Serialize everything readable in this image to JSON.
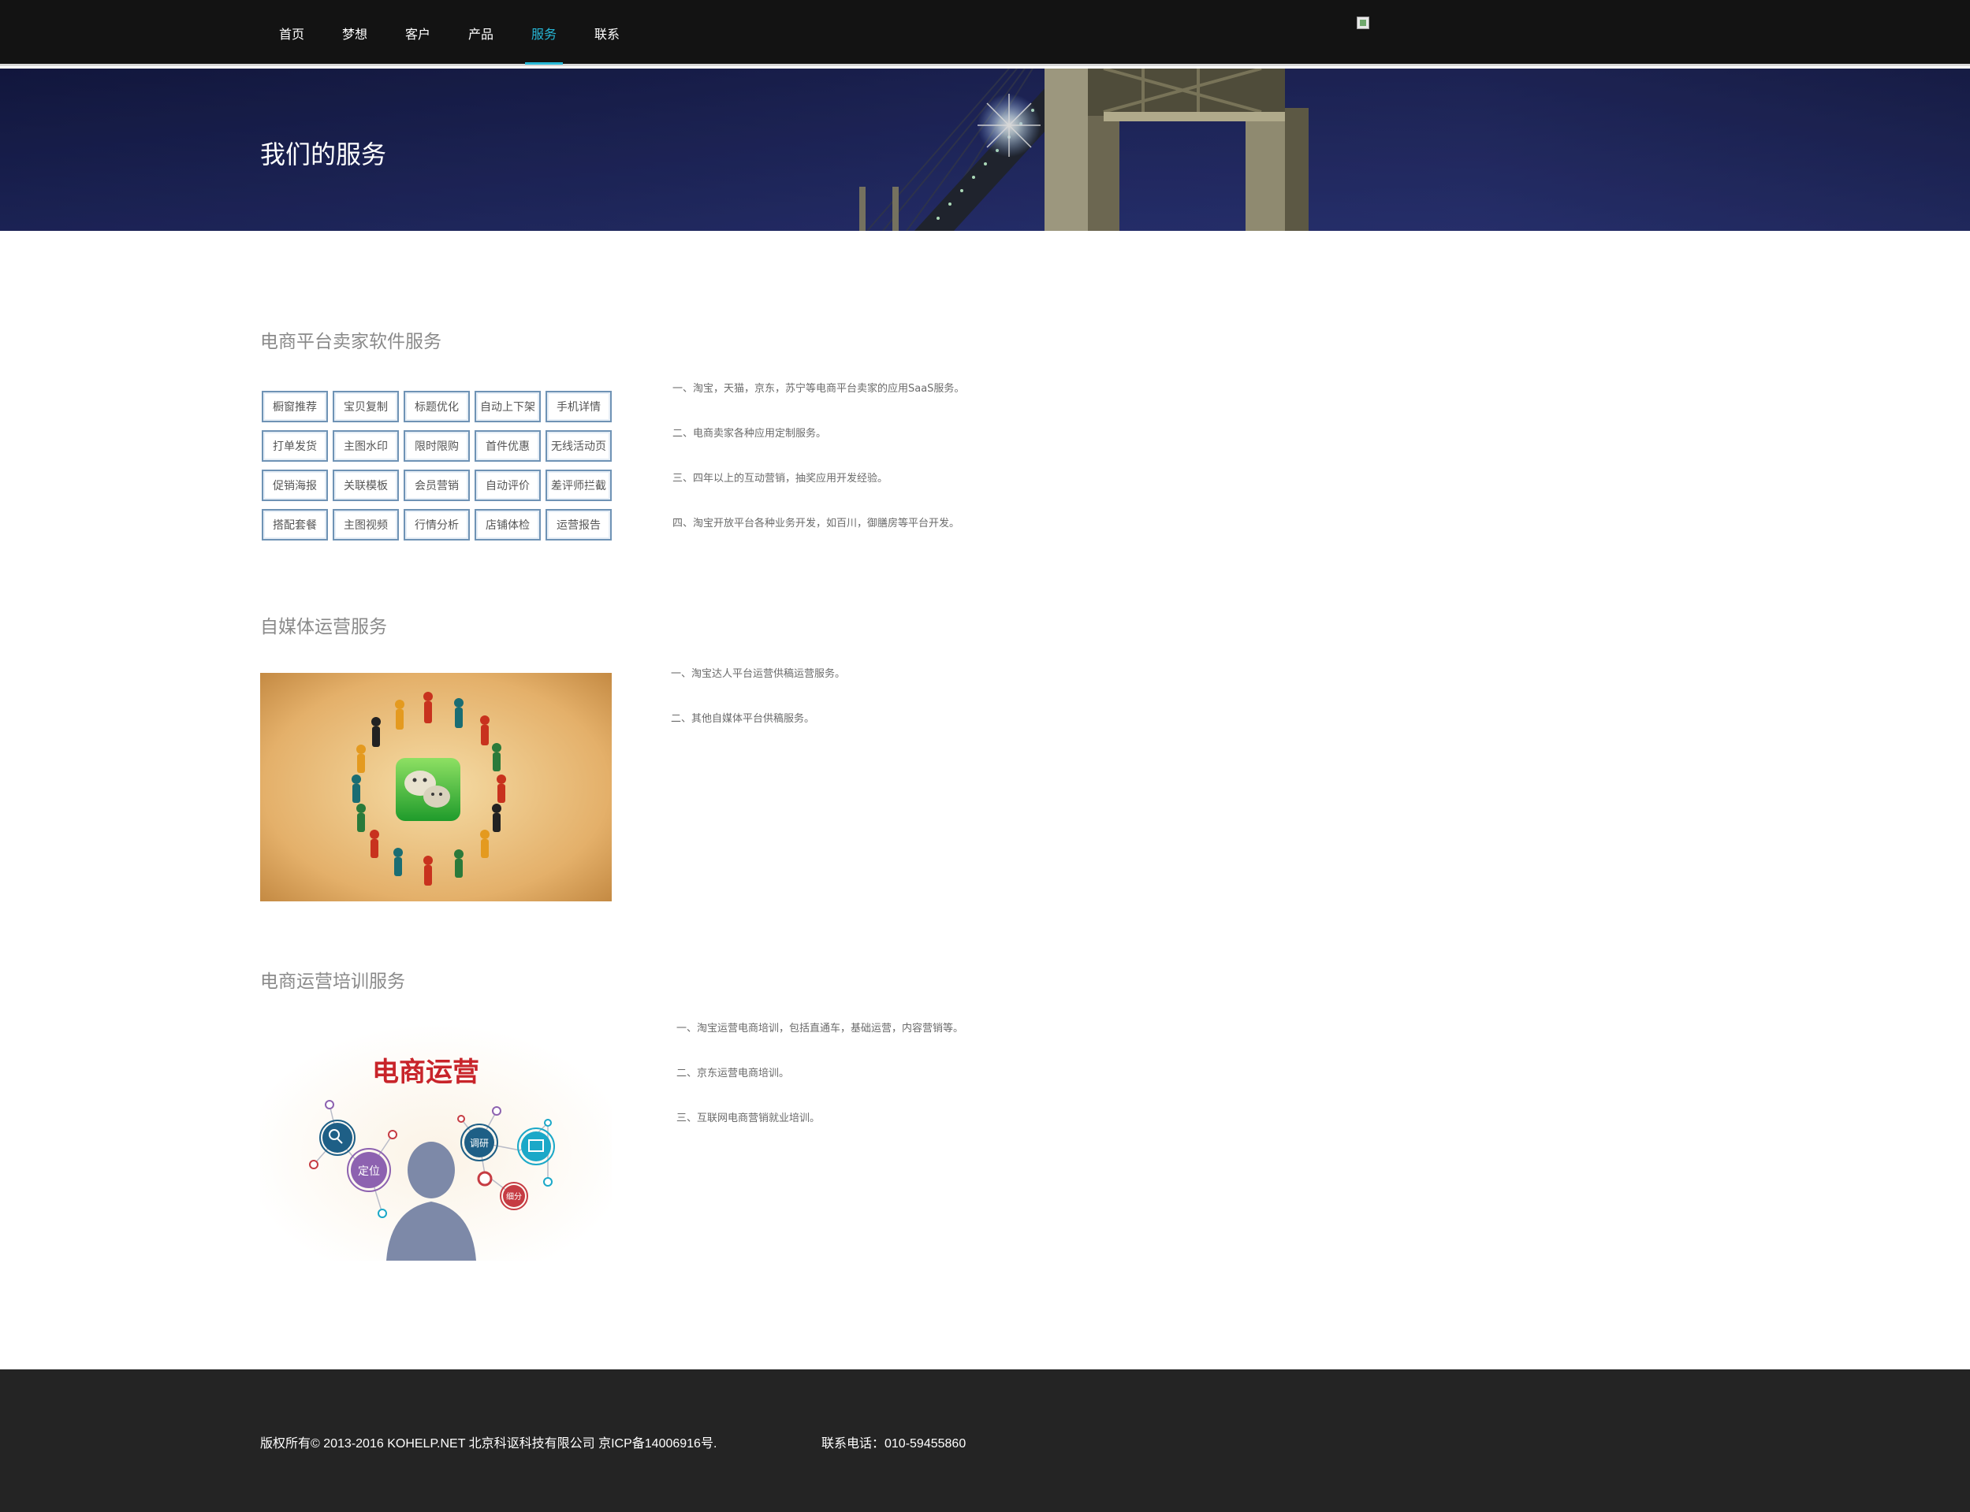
{
  "nav": {
    "items": [
      {
        "label": "首页"
      },
      {
        "label": "梦想"
      },
      {
        "label": "客户"
      },
      {
        "label": "产品"
      },
      {
        "label": "服务",
        "active": true
      },
      {
        "label": "联系"
      }
    ]
  },
  "banner": {
    "title": "我们的服务"
  },
  "section1": {
    "title": "电商平台卖家软件服务",
    "tags": [
      "橱窗推荐",
      "宝贝复制",
      "标题优化",
      "自动上下架",
      "手机详情",
      "打单发货",
      "主图水印",
      "限时限购",
      "首件优惠",
      "无线活动页",
      "促销海报",
      "关联模板",
      "会员营销",
      "自动评价",
      "差评师拦截",
      "搭配套餐",
      "主图视频",
      "行情分析",
      "店铺体检",
      "运营报告"
    ],
    "items": [
      "一、淘宝，天猫，京东，苏宁等电商平台卖家的应用SaaS服务。",
      "二、电商卖家各种应用定制服务。",
      "三、四年以上的互动营销，抽奖应用开发经验。",
      "四、淘宝开放平台各种业务开发，如百川，御膳房等平台开发。"
    ]
  },
  "section2": {
    "title": "自媒体运营服务",
    "items": [
      "一、淘宝达人平台运营供稿运营服务。",
      "二、其他自媒体平台供稿服务。"
    ]
  },
  "section3": {
    "title": "电商运营培训服务",
    "image_title": "电商运营",
    "image_labels": {
      "locate": "定位",
      "research": "调研",
      "detail": "细分"
    },
    "items": [
      "一、淘宝运营电商培训，包括直通车，基础运营，内容营销等。",
      "二、京东运营电商培训。",
      "三、互联网电商营销就业培训。"
    ]
  },
  "footer": {
    "copyright": "版权所有© 2013-2016 KOHELP.NET 北京科讴科技有限公司 京ICP备14006916号.",
    "phone": "联系电话：010-59455860"
  },
  "colors": {
    "nav_bg": "#131313",
    "nav_active": "#27b7d6",
    "footer_bg": "#242424",
    "tag_border": "#6f93b5"
  }
}
